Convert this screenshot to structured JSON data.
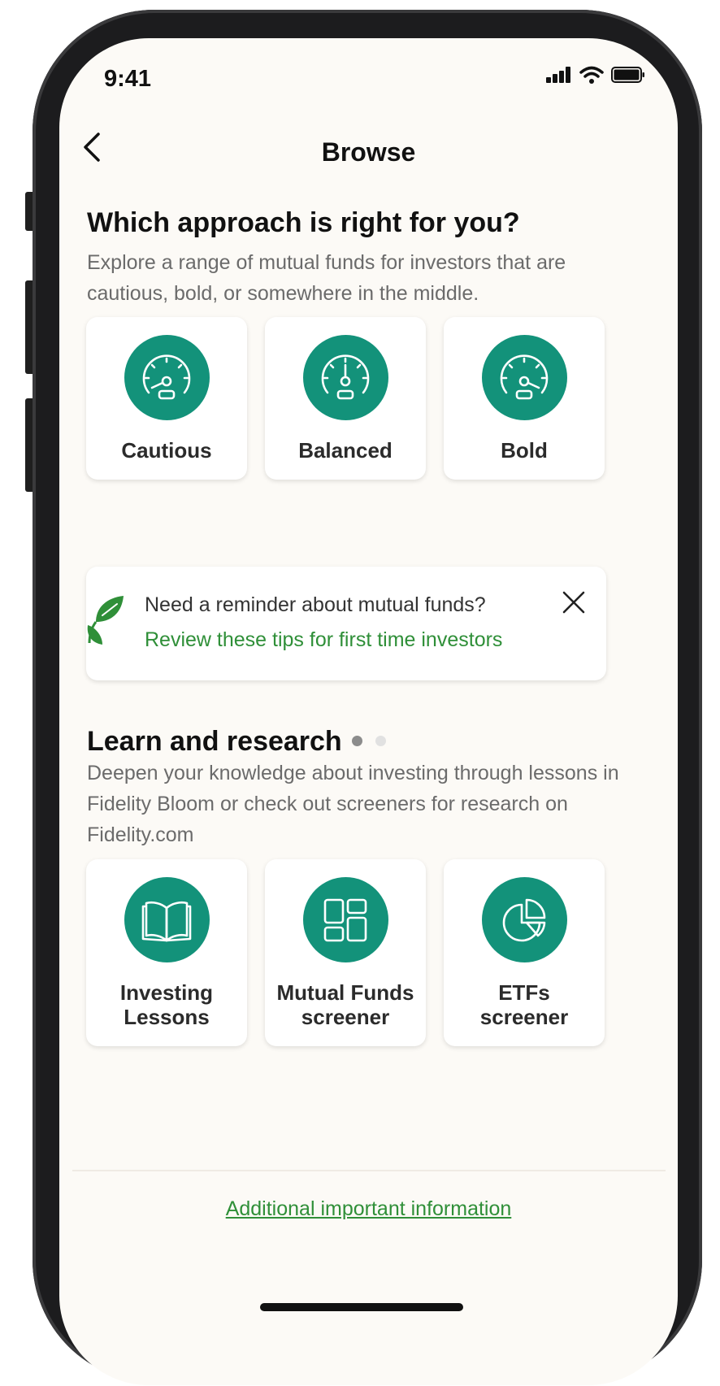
{
  "status": {
    "time": "9:41"
  },
  "nav": {
    "title": "Browse"
  },
  "approach": {
    "title": "Which approach is right for you?",
    "description": "Explore a range of mutual funds for investors that are cautious, bold, or somewhere in the middle.",
    "cards": [
      {
        "label": "Cautious",
        "icon": "gauge-low-icon"
      },
      {
        "label": "Balanced",
        "icon": "gauge-mid-icon"
      },
      {
        "label": "Bold",
        "icon": "gauge-high-icon"
      }
    ]
  },
  "reminder": {
    "question": "Need a reminder about mutual funds?",
    "link": "Review these tips for first time investors",
    "page_count": 2,
    "active_page": 1
  },
  "learn": {
    "title": "Learn and research",
    "description": "Deepen your knowledge about investing through lessons in Fidelity Bloom or check out screeners for research on Fidelity.com",
    "cards": [
      {
        "line1": "Investing",
        "line2": "Lessons",
        "icon": "book-icon"
      },
      {
        "line1": "Mutual Funds",
        "line2": "screener",
        "icon": "grid-icon"
      },
      {
        "line1": "ETFs",
        "line2": "screener",
        "icon": "pie-chart-icon"
      }
    ]
  },
  "footer": {
    "link": "Additional important information"
  },
  "colors": {
    "accent_teal": "#13927a",
    "link_green": "#2f8f38",
    "background": "#fcfaf6"
  }
}
